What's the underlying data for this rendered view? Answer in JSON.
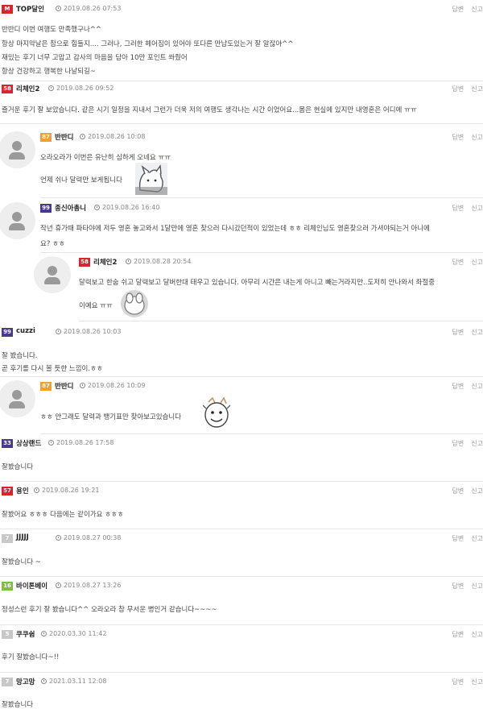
{
  "ui": {
    "reply_label": "답변",
    "report_label": "신고"
  },
  "comments": [
    {
      "level": "M",
      "level_color": "#d9232d",
      "nick": "TOP달인",
      "time": "2019.08.26 07:53",
      "lines": [
        "반반디 이번 여행도 만족했구나^^",
        "항상 마지막날은 참으로 힘들지.... 그러나, 그러한 헤어짐이 있어야 또다른 만남도있는거 잘 알잖아^^",
        "재밌는 후기 너무 고맙고 감사의 마음을 담아 10만 포인트 쏴줬어",
        "항상 건강하고 행복한 나날되길~"
      ]
    },
    {
      "level": "58",
      "level_color": "#d9232d",
      "nick": "리체인2",
      "time": "2019.08.26 09:52",
      "lines": [
        "즐거운 후기 잘 보았습니다. 같은 시기 일정을 지내서 그런가 더욱 저의 여행도 생각나는 시간 이었어요...몸은 현실에 있지만 내영혼은 어디에 ㅠㅠ"
      ]
    },
    {
      "level": "87",
      "level_color": "#f0a030",
      "nick": "반반디",
      "time": "2019.08.26 10:08",
      "lines": [
        "오라오라가 이번은 유난히 심하게 오네요 ㅠㅠ",
        "언제 쉬나 달력만 보게됩니다"
      ]
    },
    {
      "level": "99",
      "level_color": "#4a3a8a",
      "nick": "종신아총니",
      "time": "2019.08.26 16:40",
      "lines": [
        "작년 휴가때 파타야에 저두 영혼 놓고와서 1달만에 영혼 찾으러 다시갔던적이 있었는데 ㅎㅎ 리체인님도 영혼찾으러 가셔야되는거 아니에",
        "요? ㅎㅎ"
      ]
    },
    {
      "level": "58",
      "level_color": "#d9232d",
      "nick": "리체인2",
      "time": "2019.08.28 20:54",
      "lines": [
        "달력보고 한숨 쉬고 달력보고 달버한대 태우고 있습니다. 아무리 시간은 내는게 아니고 빼는거라지만..도저히 안나와서 좌절중",
        "이예요 ㅠㅠ"
      ]
    },
    {
      "level": "99",
      "level_color": "#4a3a8a",
      "nick": "cuzzi",
      "time": "2019.08.26 10:03",
      "lines": [
        "잘 봤습니다.",
        "곧 후기를 다시 볼 듯한 느낌이.ㅎㅎ"
      ]
    },
    {
      "level": "87",
      "level_color": "#f0a030",
      "nick": "반반디",
      "time": "2019.08.26 10:09",
      "lines": [
        "ㅎㅎ 안그래도 달력과 뱅기표만 찾아보고있습니다"
      ]
    },
    {
      "level": "33",
      "level_color": "#4a3a8a",
      "nick": "상상랜드",
      "time": "2019.08.26 17:58",
      "lines": [
        "잘봤습니다"
      ]
    },
    {
      "level": "57",
      "level_color": "#d9232d",
      "nick": "용인",
      "time": "2019.08.26 19:21",
      "lines": [
        "잘봤어요 ㅎㅎㅎ 다음에는 같이가요 ㅎㅎㅎ"
      ]
    },
    {
      "level": "7",
      "level_color": "#c8c8c8",
      "nick": "JJJJJ",
      "time": "2019.08.27 00:38",
      "lines": [
        "잘봤습니다 ~"
      ]
    },
    {
      "level": "16",
      "level_color": "#7cc040",
      "nick": "바이톤베이",
      "time": "2019.08.27 13:26",
      "lines": [
        "정성스런 후기 잘 봤습니다^^ 오라오라 참 무서운 병인거 같습니다~~~~"
      ]
    },
    {
      "level": "5",
      "level_color": "#c8c8c8",
      "nick": "쿠쿠쉼",
      "time": "2020.03.30 11:42",
      "lines": [
        "후기 잘봤습니다~!!"
      ]
    },
    {
      "level": "7",
      "level_color": "#c8c8c8",
      "nick": "망고망",
      "time": "2021.03.11 12:08",
      "lines": [
        "잘봤습니다"
      ]
    }
  ]
}
